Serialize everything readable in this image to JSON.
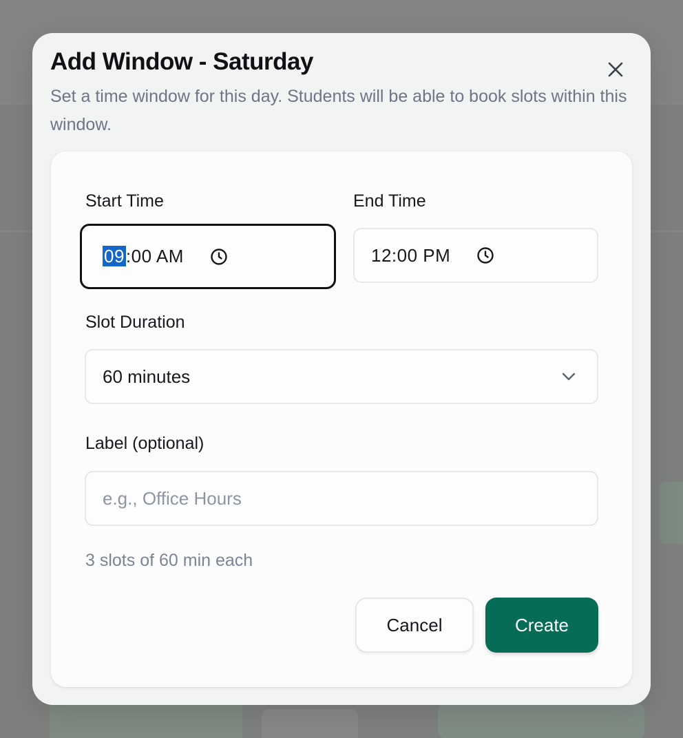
{
  "dialog": {
    "title": "Add Window - Saturday",
    "description": "Set a time window for this day. Students will be able to book slots within this window.",
    "close_icon": "close-icon"
  },
  "form": {
    "start_time": {
      "label": "Start Time",
      "hour": "09",
      "rest": ":00 AM",
      "icon": "clock-icon"
    },
    "end_time": {
      "label": "End Time",
      "value": "12:00 PM",
      "icon": "clock-icon"
    },
    "slot_duration": {
      "label": "Slot Duration",
      "value": "60 minutes",
      "icon": "chevron-down-icon"
    },
    "label_field": {
      "label": "Label (optional)",
      "placeholder": "e.g., Office Hours",
      "value": ""
    },
    "summary": "3 slots of 60 min each"
  },
  "actions": {
    "cancel_label": "Cancel",
    "create_label": "Create"
  },
  "colors": {
    "primary": "#066b57",
    "focus_border": "#0f1115",
    "selection": "#1466c8",
    "muted_text": "#6d7586"
  }
}
